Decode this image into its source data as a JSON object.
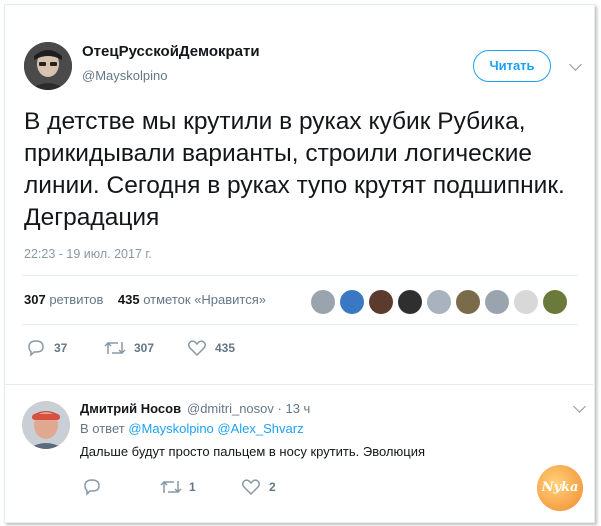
{
  "tweet": {
    "author_name": "ОтецРусскойДемократи",
    "author_handle": "@Mayskolpino",
    "follow_label": "Читать",
    "text": "В детстве мы крутили в руках кубик Рубика, прикидывали варианты, строили логические линии. Сегодня в руках тупо крутят подшипник. Деградация",
    "timestamp": "22:23 - 19 июл. 2017 г.",
    "retweets_count": "307",
    "retweets_label": "ретвитов",
    "likes_count": "435",
    "likes_label": "отметок «Нравится»",
    "actions": {
      "reply_count": "37",
      "retweet_count": "307",
      "like_count": "435"
    },
    "likers": [
      {
        "icon": "liker-avatar-1",
        "color": "#9aa4ae"
      },
      {
        "icon": "liker-avatar-2",
        "color": "#3b78c4"
      },
      {
        "icon": "liker-avatar-3",
        "color": "#5a3b2e"
      },
      {
        "icon": "liker-avatar-4",
        "color": "#2f2f2f"
      },
      {
        "icon": "liker-avatar-5",
        "color": "#a8b3bd"
      },
      {
        "icon": "liker-avatar-6",
        "color": "#7a6b4a"
      },
      {
        "icon": "liker-avatar-7",
        "color": "#9aa4ae"
      },
      {
        "icon": "liker-avatar-8",
        "color": "#d8d8d8"
      },
      {
        "icon": "liker-avatar-9",
        "color": "#6b7a3a"
      }
    ]
  },
  "reply": {
    "author_name": "Дмитрий Носов",
    "author_handle": "@dmitri_nosov",
    "time": "· 13 ч",
    "in_reply_prefix": "В ответ",
    "mention_1": "@Mayskolpino",
    "mention_2": "@Alex_Shvarz",
    "text": "Дальше будут просто пальцем в носу крутить. Эволюция",
    "retweet_count": "1",
    "like_count": "2"
  },
  "watermark": {
    "text": "Nyka"
  },
  "colors": {
    "accent": "#1da1f2",
    "muted": "#657786",
    "light": "#8899a6",
    "border": "#e6ecf0"
  }
}
